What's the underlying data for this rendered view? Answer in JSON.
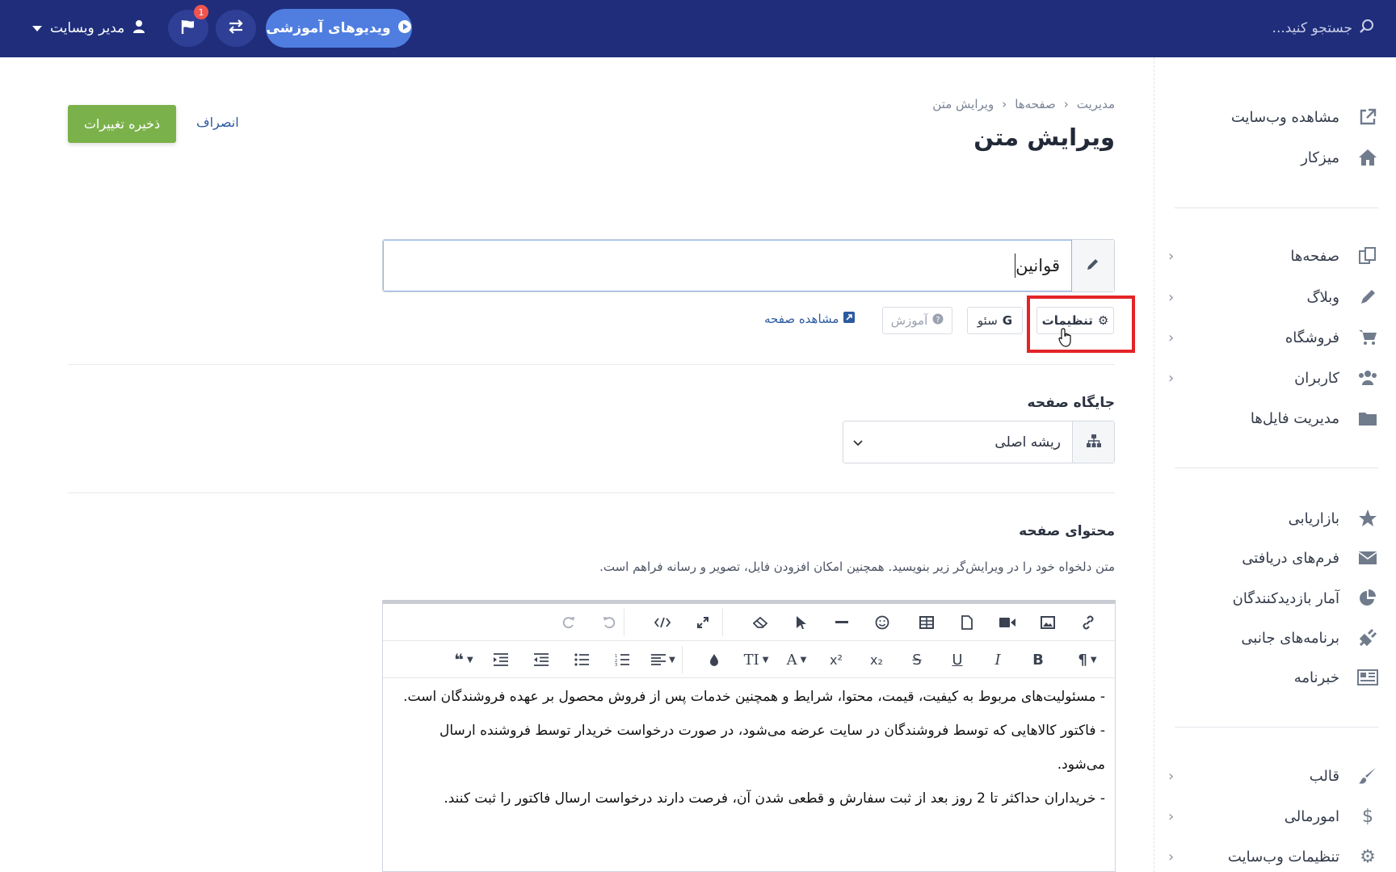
{
  "topbar": {
    "search_placeholder": "جستجو کنید...",
    "user_label": "مدیر وبسایت",
    "notifications_count": "1",
    "videos_label": "ویدیوهای آموزشی"
  },
  "sidebar": {
    "items": [
      {
        "label": "مشاهده وب‌سایت",
        "icon": "external-link-icon"
      },
      {
        "label": "میزکار",
        "icon": "home-icon"
      },
      {
        "label": "صفحه‌ها",
        "icon": "pages-icon"
      },
      {
        "label": "وبلاگ",
        "icon": "pencil-icon"
      },
      {
        "label": "فروشگاه",
        "icon": "cart-icon"
      },
      {
        "label": "کاربران",
        "icon": "users-icon"
      },
      {
        "label": "مدیریت فایل‌ها",
        "icon": "folder-icon"
      },
      {
        "label": "بازاریابی",
        "icon": "star-icon"
      },
      {
        "label": "فرم‌های دریافتی",
        "icon": "envelope-icon"
      },
      {
        "label": "آمار بازدیدکنندگان",
        "icon": "pie-chart-icon"
      },
      {
        "label": "برنامه‌های جانبی",
        "icon": "plug-icon"
      },
      {
        "label": "خبرنامه",
        "icon": "newspaper-icon"
      },
      {
        "label": "قالب",
        "icon": "brush-icon"
      },
      {
        "label": "امورمالی",
        "icon": "dollar-icon"
      },
      {
        "label": "تنظیمات وب‌سایت",
        "icon": "gear-icon"
      }
    ]
  },
  "header": {
    "breadcrumb": [
      "مدیریت",
      "صفحه‌ها",
      "ویرایش متن"
    ],
    "title": "ویرایش متن",
    "save_label": "ذخیره تغییرات",
    "cancel_label": "انصراف"
  },
  "form": {
    "title_value": "قوانین",
    "tabs": {
      "settings": "تنظیمات",
      "seo": "سئو",
      "training": "آموزش",
      "view_page": "مشاهده صفحه"
    },
    "location_label": "جایگاه صفحه",
    "location_value": "ریشه اصلی",
    "content_label": "محتوای صفحه",
    "content_help": "متن دلخواه خود را در ویرایش‌گر زیر بنویسید. همچنین امکان افزودن فایل، تصویر و رسانه فراهم است."
  },
  "editor": {
    "paragraphs": [
      "- مسئولیت‌های مربوط به کیفیت، قیمت، محتوا، شرایط و همچنین خدمات پس از فروش محصول بر عهده فروشندگان است.",
      "- فاکتور کالاهایی که توسط فروشندگان در سایت عرضه می‌شود، در صورت درخواست خریدار توسط فروشنده ارسال می‌شود.",
      "- خریداران حداکثر تا 2 روز بعد از ثبت سفارش و قطعی شدن آن، فرصت دارند درخواست ارسال فاکتور را ثبت کنند."
    ]
  },
  "colors": {
    "topbar": "#1f2d7b",
    "accent_button": "#4f7ee0",
    "save_button": "#7bb14a",
    "highlight": "#e32427"
  }
}
